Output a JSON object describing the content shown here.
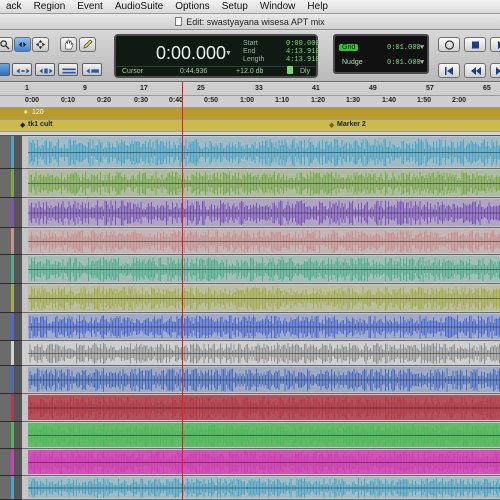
{
  "menu": {
    "items": [
      "ack",
      "Region",
      "Event",
      "AudioSuite",
      "Options",
      "Setup",
      "Window",
      "Help"
    ]
  },
  "title": "Edit: swastyayana wisesa APT mix",
  "counter": {
    "main": "0:00.000",
    "cursor_label": "Cursor",
    "cursor_value": "0:44.936",
    "level": "+12.0 db",
    "dly_label": "Dly",
    "start_label": "Start",
    "start_value": "0:00.000",
    "end_label": "End",
    "end_value": "4:13.910",
    "length_label": "Length",
    "length_value": "4:13.910"
  },
  "grid": {
    "grid_label": "Grid",
    "grid_value": "0:01.000",
    "nudge_label": "Nudge",
    "nudge_value": "0:01.000"
  },
  "ruler": {
    "bars": [
      "1",
      "9",
      "17",
      "25",
      "33",
      "41",
      "49",
      "57",
      "65"
    ],
    "minsecs": [
      "0:00",
      "0:10",
      "0:20",
      "0:30",
      "0:40",
      "0:50",
      "1:00",
      "1:10",
      "1:20",
      "1:30",
      "1:40",
      "1:50",
      "2:00"
    ],
    "tempo_label": "120",
    "marker_label_1": "tk1 cult",
    "marker_label_2": "Marker 2"
  },
  "colors": {
    "track_colors": [
      "#4aa5c8",
      "#78a84a",
      "#7b55b8",
      "#c89090",
      "#4fae8f",
      "#a4ac4c",
      "#4a6ad0",
      "#d2d2d2",
      "#466cc0",
      "#b03c48",
      "#4fb85a",
      "#cf3fb3"
    ]
  }
}
